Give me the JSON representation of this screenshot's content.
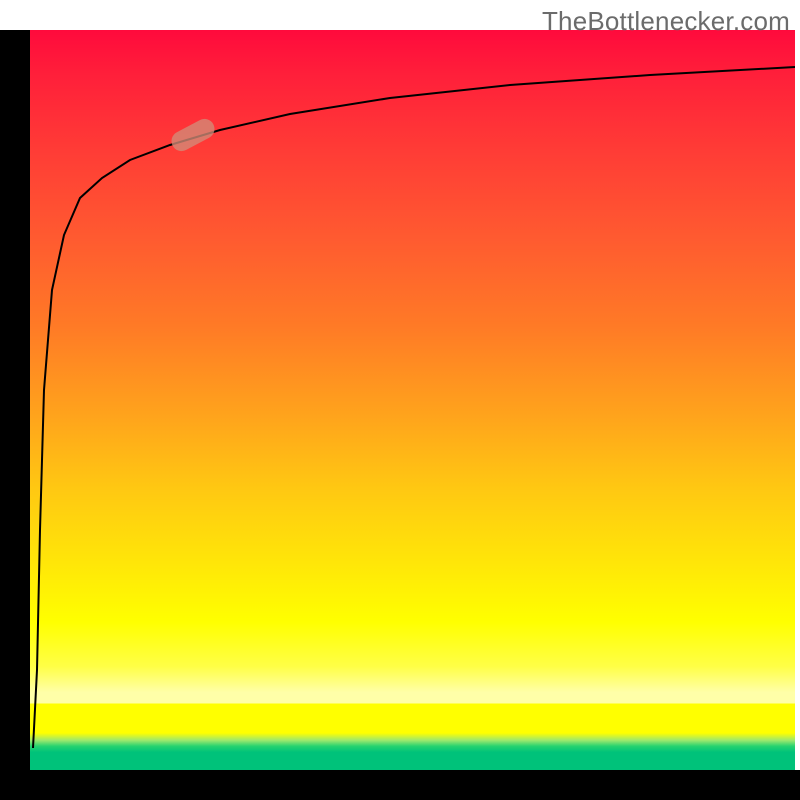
{
  "watermark": "TheBottlenecker.com",
  "chart_data": {
    "type": "line",
    "title": "",
    "xlabel": "",
    "ylabel": "",
    "xlim": [
      0,
      100
    ],
    "ylim": [
      0,
      100
    ],
    "series": [
      {
        "name": "bottleneck-curve",
        "x": [
          0.5,
          0.8,
          1.2,
          2.0,
          3.0,
          4.0,
          6.0,
          8.0,
          10.0,
          14.0,
          20.0,
          30.0,
          45.0,
          60.0,
          80.0,
          100.0
        ],
        "y": [
          3,
          22,
          45,
          60,
          68,
          73,
          78,
          80.5,
          82.5,
          85,
          87.5,
          90,
          92,
          93.3,
          94.5,
          95.5
        ]
      }
    ],
    "marker": {
      "x": 20,
      "y": 83,
      "angle_deg": -28
    }
  },
  "colors": {
    "top": "#ff0a3c",
    "mid": "#ffe608",
    "band_pale": "#ffffa8",
    "green": "#00c27a",
    "frame": "#000000",
    "watermark": "#6b6b6b",
    "marker": "#d28c78"
  }
}
